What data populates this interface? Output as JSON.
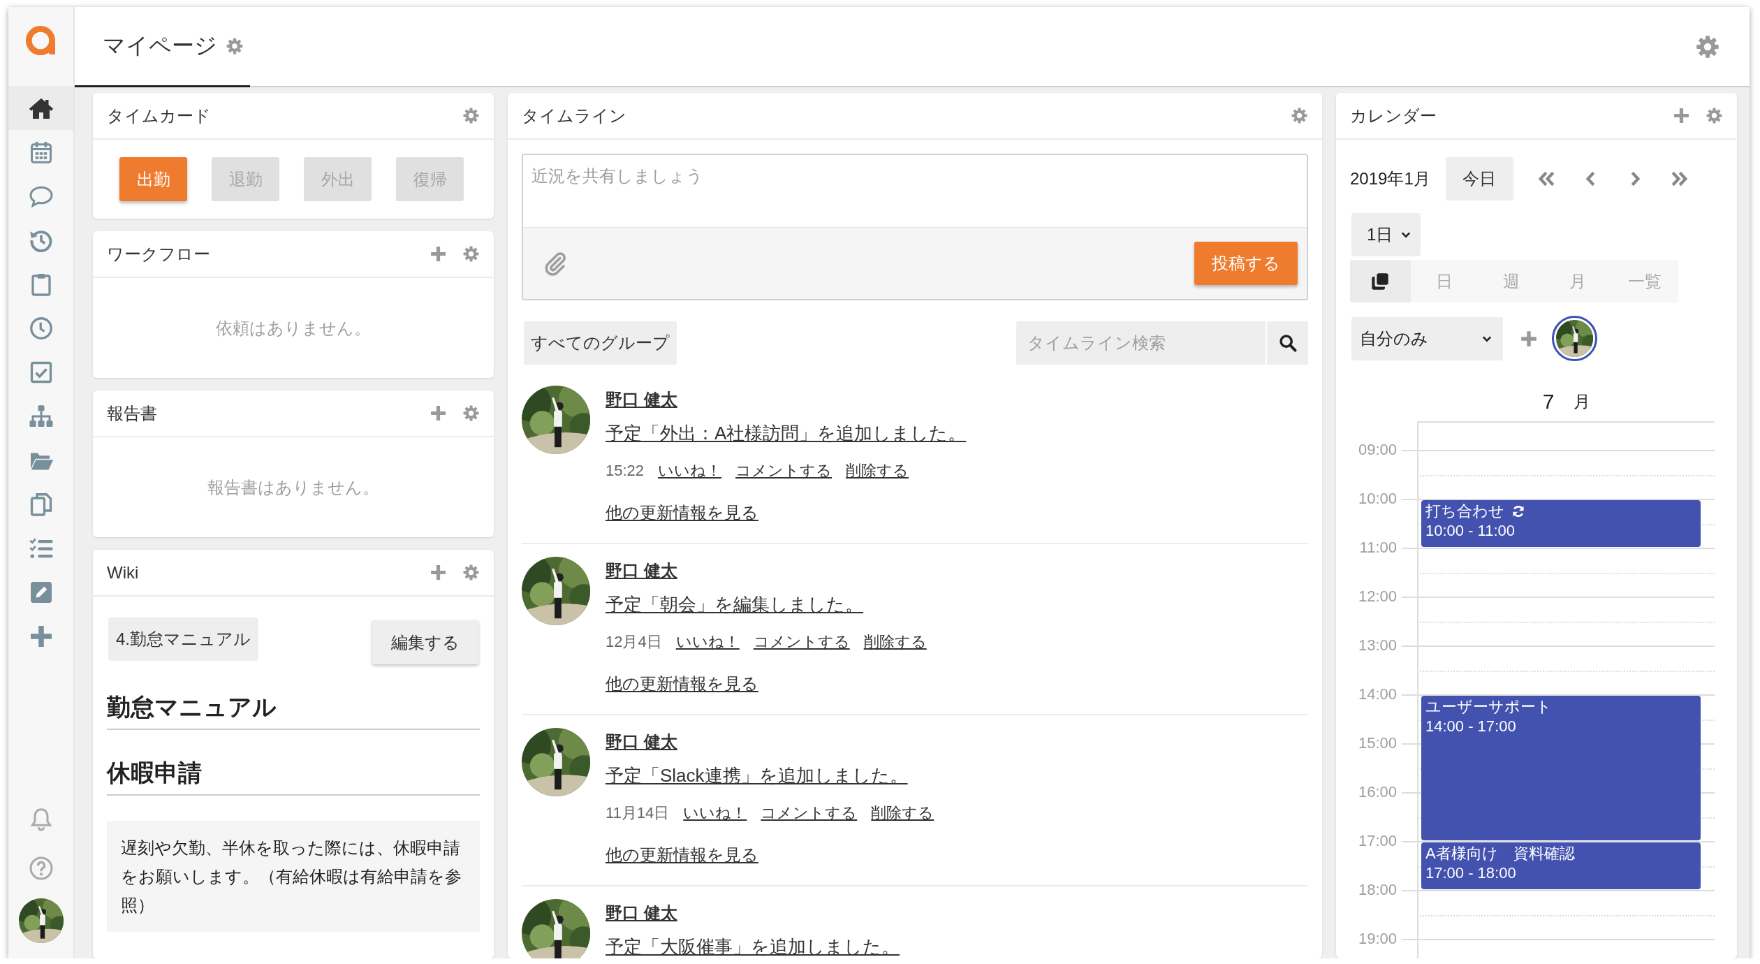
{
  "sidebar": {
    "items": [
      {
        "selected": true
      },
      {
        "selected": false
      },
      {
        "selected": false
      },
      {
        "selected": false
      },
      {
        "selected": false
      },
      {
        "selected": false
      },
      {
        "selected": false
      },
      {
        "selected": false
      },
      {
        "selected": false
      },
      {
        "selected": false
      },
      {
        "selected": false
      },
      {
        "selected": false
      },
      {
        "selected": false
      }
    ]
  },
  "header": {
    "title": "マイページ"
  },
  "timecard": {
    "title": "タイムカード",
    "buttons": [
      {
        "label": "出勤",
        "disabled": false
      },
      {
        "label": "退勤",
        "disabled": true
      },
      {
        "label": "外出",
        "disabled": true
      },
      {
        "label": "復帰",
        "disabled": true
      }
    ]
  },
  "workflow": {
    "title": "ワークフロー",
    "empty": "依頼はありません。"
  },
  "reports": {
    "title": "報告書",
    "empty": "報告書はありません。"
  },
  "wiki": {
    "title": "Wiki",
    "page": "4.勤怠マニュアル",
    "edit_button": "編集する",
    "heading": "勤怠マニュアル",
    "subheading": "休暇申請",
    "note": "遅刻や欠勤、半休を取った際には、休暇申請をお願いします。（有給休暇は有給申請を参照）"
  },
  "timeline": {
    "title": "タイムライン",
    "composer": {
      "placeholder": "近況を共有しましょう",
      "post_button": "投稿する"
    },
    "group_button": "すべてのグループ",
    "search": {
      "placeholder": "タイムライン検索"
    },
    "posts": [
      {
        "author": "野口 健太",
        "text": "予定「外出：A社様訪問」を追加しました。",
        "time": "15:22",
        "actions": [
          "いいね！",
          "コメントする",
          "削除する"
        ],
        "more": "他の更新情報を見る"
      },
      {
        "author": "野口 健太",
        "text": "予定「朝会」を編集しました。",
        "time": "12月4日",
        "actions": [
          "いいね！",
          "コメントする",
          "削除する"
        ],
        "more": "他の更新情報を見る"
      },
      {
        "author": "野口 健太",
        "text": "予定「Slack連携」を追加しました。",
        "time": "11月14日",
        "actions": [
          "いいね！",
          "コメントする",
          "削除する"
        ],
        "more": "他の更新情報を見る"
      },
      {
        "author": "野口 健太",
        "text": "予定「大阪催事」を追加しました。"
      }
    ]
  },
  "calendar": {
    "title": "カレンダー",
    "month": "2019年1月",
    "today_button": "今日",
    "range": {
      "value": "1日"
    },
    "view_modes": [
      {
        "kind": "icon",
        "selected": true
      },
      {
        "kind": "text",
        "label": "日",
        "selected": false
      },
      {
        "kind": "text",
        "label": "週",
        "selected": false
      },
      {
        "kind": "text",
        "label": "月",
        "selected": false
      },
      {
        "kind": "text",
        "label": "一覧",
        "selected": false
      }
    ],
    "member_filter": {
      "value": "自分のみ"
    },
    "day_header": {
      "date": "7",
      "weekday": "月"
    },
    "hours": [
      "09:00",
      "10:00",
      "11:00",
      "12:00",
      "13:00",
      "14:00",
      "15:00",
      "16:00",
      "17:00",
      "18:00",
      "19:00"
    ],
    "events": [
      {
        "title": "打ち合わせ",
        "time": "10:00 - 11:00",
        "recurring": true
      },
      {
        "title": "ユーザーサポート",
        "time": "14:00 - 17:00",
        "recurring": false
      },
      {
        "title": "A者様向け　資料確認",
        "time": "17:00 - 18:00",
        "recurring": false
      }
    ]
  }
}
